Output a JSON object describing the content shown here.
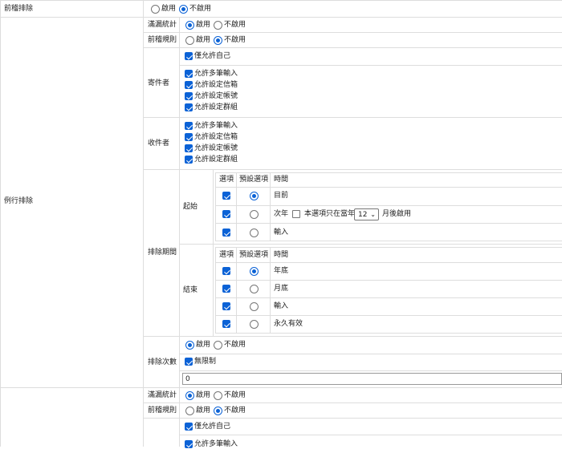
{
  "options": {
    "enable": "啟用",
    "disable": "不啟用"
  },
  "row_prev_exclude": {
    "label": "前稽排除",
    "selected": "disable"
  },
  "routine_exclude": {
    "label": "例行排除",
    "leak_stats": {
      "label": "滿漏統計",
      "selected": "enable"
    },
    "prev_rule": {
      "label": "前稽規則",
      "selected": "disable"
    },
    "sender": {
      "label": "寄件者",
      "only_self": "僅允許自己",
      "items": [
        "允許多筆輸入",
        "允許設定信箱",
        "允許設定帳號",
        "允許設定群組"
      ]
    },
    "recipient": {
      "label": "收件者",
      "items": [
        "允許多筆輸入",
        "允許設定信箱",
        "允許設定帳號",
        "允許設定群組"
      ]
    },
    "period": {
      "label": "排除期間",
      "headers": {
        "option": "選項",
        "default": "預設選項",
        "time": "時間"
      },
      "start": {
        "label": "起始",
        "rows": [
          {
            "checked": true,
            "default": true,
            "time": "目前"
          },
          {
            "checked": true,
            "default": false,
            "time": "次年"
          },
          {
            "checked": true,
            "default": false,
            "time": "輸入"
          }
        ],
        "next_year_extra": {
          "checked": false,
          "before": "本選項只在當年",
          "month": "12",
          "after": "月後啟用"
        }
      },
      "end": {
        "label": "結束",
        "rows": [
          {
            "checked": true,
            "default": true,
            "time": "年底"
          },
          {
            "checked": true,
            "default": false,
            "time": "月底"
          },
          {
            "checked": true,
            "default": false,
            "time": "輸入"
          },
          {
            "checked": true,
            "default": false,
            "time": "永久有效"
          }
        ]
      }
    },
    "count": {
      "label": "排除次數",
      "selected": "enable",
      "unlimited": "無限制",
      "value": "0"
    }
  },
  "second_block": {
    "leak_stats": {
      "label": "滿漏統計",
      "selected": "enable"
    },
    "prev_rule": {
      "label": "前稽規則",
      "selected": "disable"
    },
    "sender": {
      "only_self": "僅允許自己",
      "first_item": "允許多筆輸入"
    }
  },
  "colors": {
    "accent": "#0b62d6",
    "grid": "#dddddd"
  }
}
